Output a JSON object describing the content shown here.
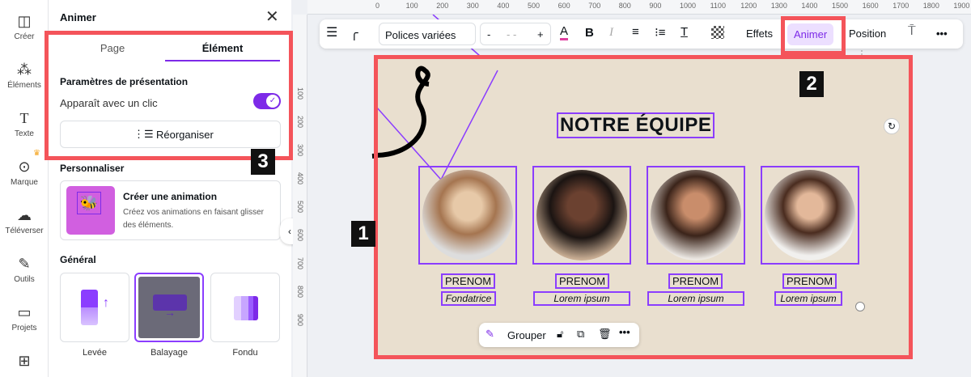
{
  "rail": [
    {
      "label": "Créer",
      "icon": "layout-icon"
    },
    {
      "label": "Éléments",
      "icon": "shapes-icon"
    },
    {
      "label": "Texte",
      "icon": "text-icon"
    },
    {
      "label": "Marque",
      "icon": "brand-icon"
    },
    {
      "label": "Téléverser",
      "icon": "upload-icon"
    },
    {
      "label": "Outils",
      "icon": "tools-icon"
    },
    {
      "label": "Projets",
      "icon": "folder-icon"
    },
    {
      "label": "",
      "icon": "apps-icon"
    }
  ],
  "panel": {
    "title": "Animer",
    "tabs": [
      "Page",
      "Élément"
    ],
    "active_tab": "Élément",
    "section1": "Paramètres de présentation",
    "toggle_label": "Apparaît avec un clic",
    "toggle_on": true,
    "reorder": "Réorganiser",
    "section2": "Personnaliser",
    "create_title": "Créer une animation",
    "create_desc": "Créez vos animations en faisant glisser des éléments.",
    "section3": "Général",
    "animations": [
      "Levée",
      "Balayage",
      "Fondu"
    ],
    "selected_animation": "Balayage"
  },
  "ruler": {
    "top": [
      "0",
      "100",
      "200",
      "300",
      "400",
      "500",
      "600",
      "700",
      "800",
      "900",
      "1000",
      "1100",
      "1200",
      "1300",
      "1400",
      "1500",
      "1600",
      "1700",
      "1800",
      "1900"
    ],
    "left": [
      "100",
      "200",
      "300",
      "400",
      "500",
      "600",
      "700",
      "800",
      "900"
    ]
  },
  "toolbar": {
    "font": "Polices variées",
    "minus": "-",
    "size": "- -",
    "plus": "+",
    "effects": "Effets",
    "animate": "Animer",
    "position": "Position"
  },
  "design": {
    "title": "NOTRE ÉQUIPE",
    "members": [
      {
        "name": "PRENOM",
        "role": "Fondatrice"
      },
      {
        "name": "PRENOM",
        "role": "Lorem ipsum"
      },
      {
        "name": "PRENOM",
        "role": "Lorem ipsum"
      },
      {
        "name": "PRENOM",
        "role": "Lorem ipsum"
      }
    ]
  },
  "floating": {
    "group": "Grouper"
  },
  "badges": [
    "1",
    "2",
    "3"
  ],
  "colors": {
    "accent": "#7d2ae8",
    "highlight": "#f4545a",
    "page": "#e9dfcf"
  }
}
